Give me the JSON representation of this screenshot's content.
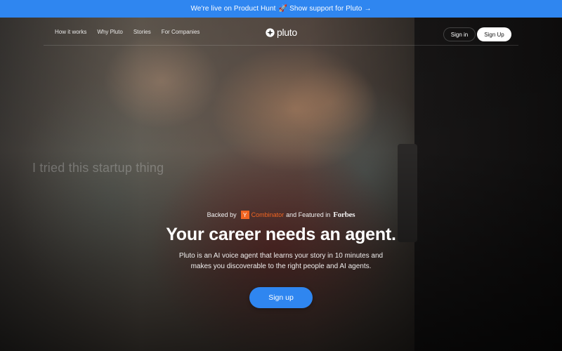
{
  "banner": {
    "text": "We're live on Product Hunt",
    "emoji": "🚀",
    "link": "Show support for Pluto",
    "arrow": "→"
  },
  "nav": {
    "links": [
      "How it works",
      "Why Pluto",
      "Stories",
      "For Companies"
    ],
    "logo_text": "pluto",
    "logo_icon": "pluto-star-icon",
    "sign_in": "Sign in",
    "sign_up": "Sign Up"
  },
  "hero": {
    "video_caption": "I tried this startup thing",
    "backed_by": "Backed by",
    "yc_letter": "Y",
    "yc_name": "Combinator",
    "featured_in": "and Featured in",
    "forbes": "Forbes",
    "headline": "Your career needs an agent.",
    "subtitle": "Pluto is an AI voice agent that learns your story in 10 minutes and makes you discoverable to the right people and AI agents.",
    "cta": "Sign up"
  },
  "colors": {
    "accent": "#2f86f0",
    "yc_orange": "#f26522"
  }
}
